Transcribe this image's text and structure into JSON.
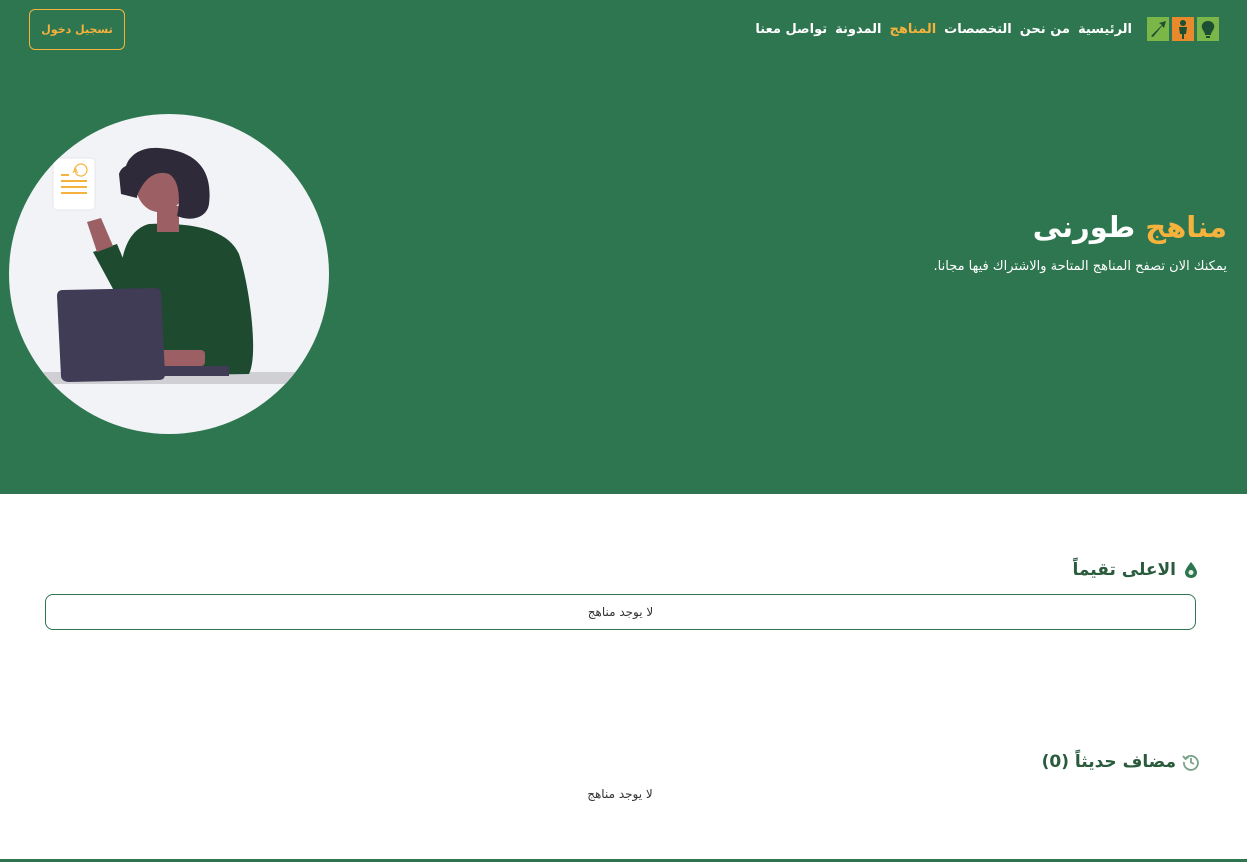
{
  "header": {
    "logo_icons": [
      "lightbulb-icon",
      "person-icon",
      "growth-arrow-icon"
    ],
    "nav": [
      {
        "label": "الرئيسية",
        "active": false
      },
      {
        "label": "من نحن",
        "active": false
      },
      {
        "label": "التخصصات",
        "active": false
      },
      {
        "label": "المناهج",
        "active": true
      },
      {
        "label": "المدونة",
        "active": false
      },
      {
        "label": "تواصل معنا",
        "active": false
      }
    ],
    "login_label": "تسجيل دخول"
  },
  "hero": {
    "title_accent": "مناهج",
    "title_rest": "طورنى",
    "subtitle": "يمكنك الان تصفح المناهج المتاحة والاشتراك فيها مجانا."
  },
  "sections": {
    "top_rated": {
      "title": "الاعلى تقيماً",
      "icon": "drop-icon",
      "empty_message": "لا يوجد مناهج"
    },
    "recent": {
      "title": "مضاف حديثاً (0)",
      "icon": "history-icon",
      "empty_message": "لا يوجد مناهج"
    }
  },
  "colors": {
    "primary_green": "#2d7650",
    "accent_orange": "#f5b23c",
    "heading_green": "#2a5b3d"
  }
}
